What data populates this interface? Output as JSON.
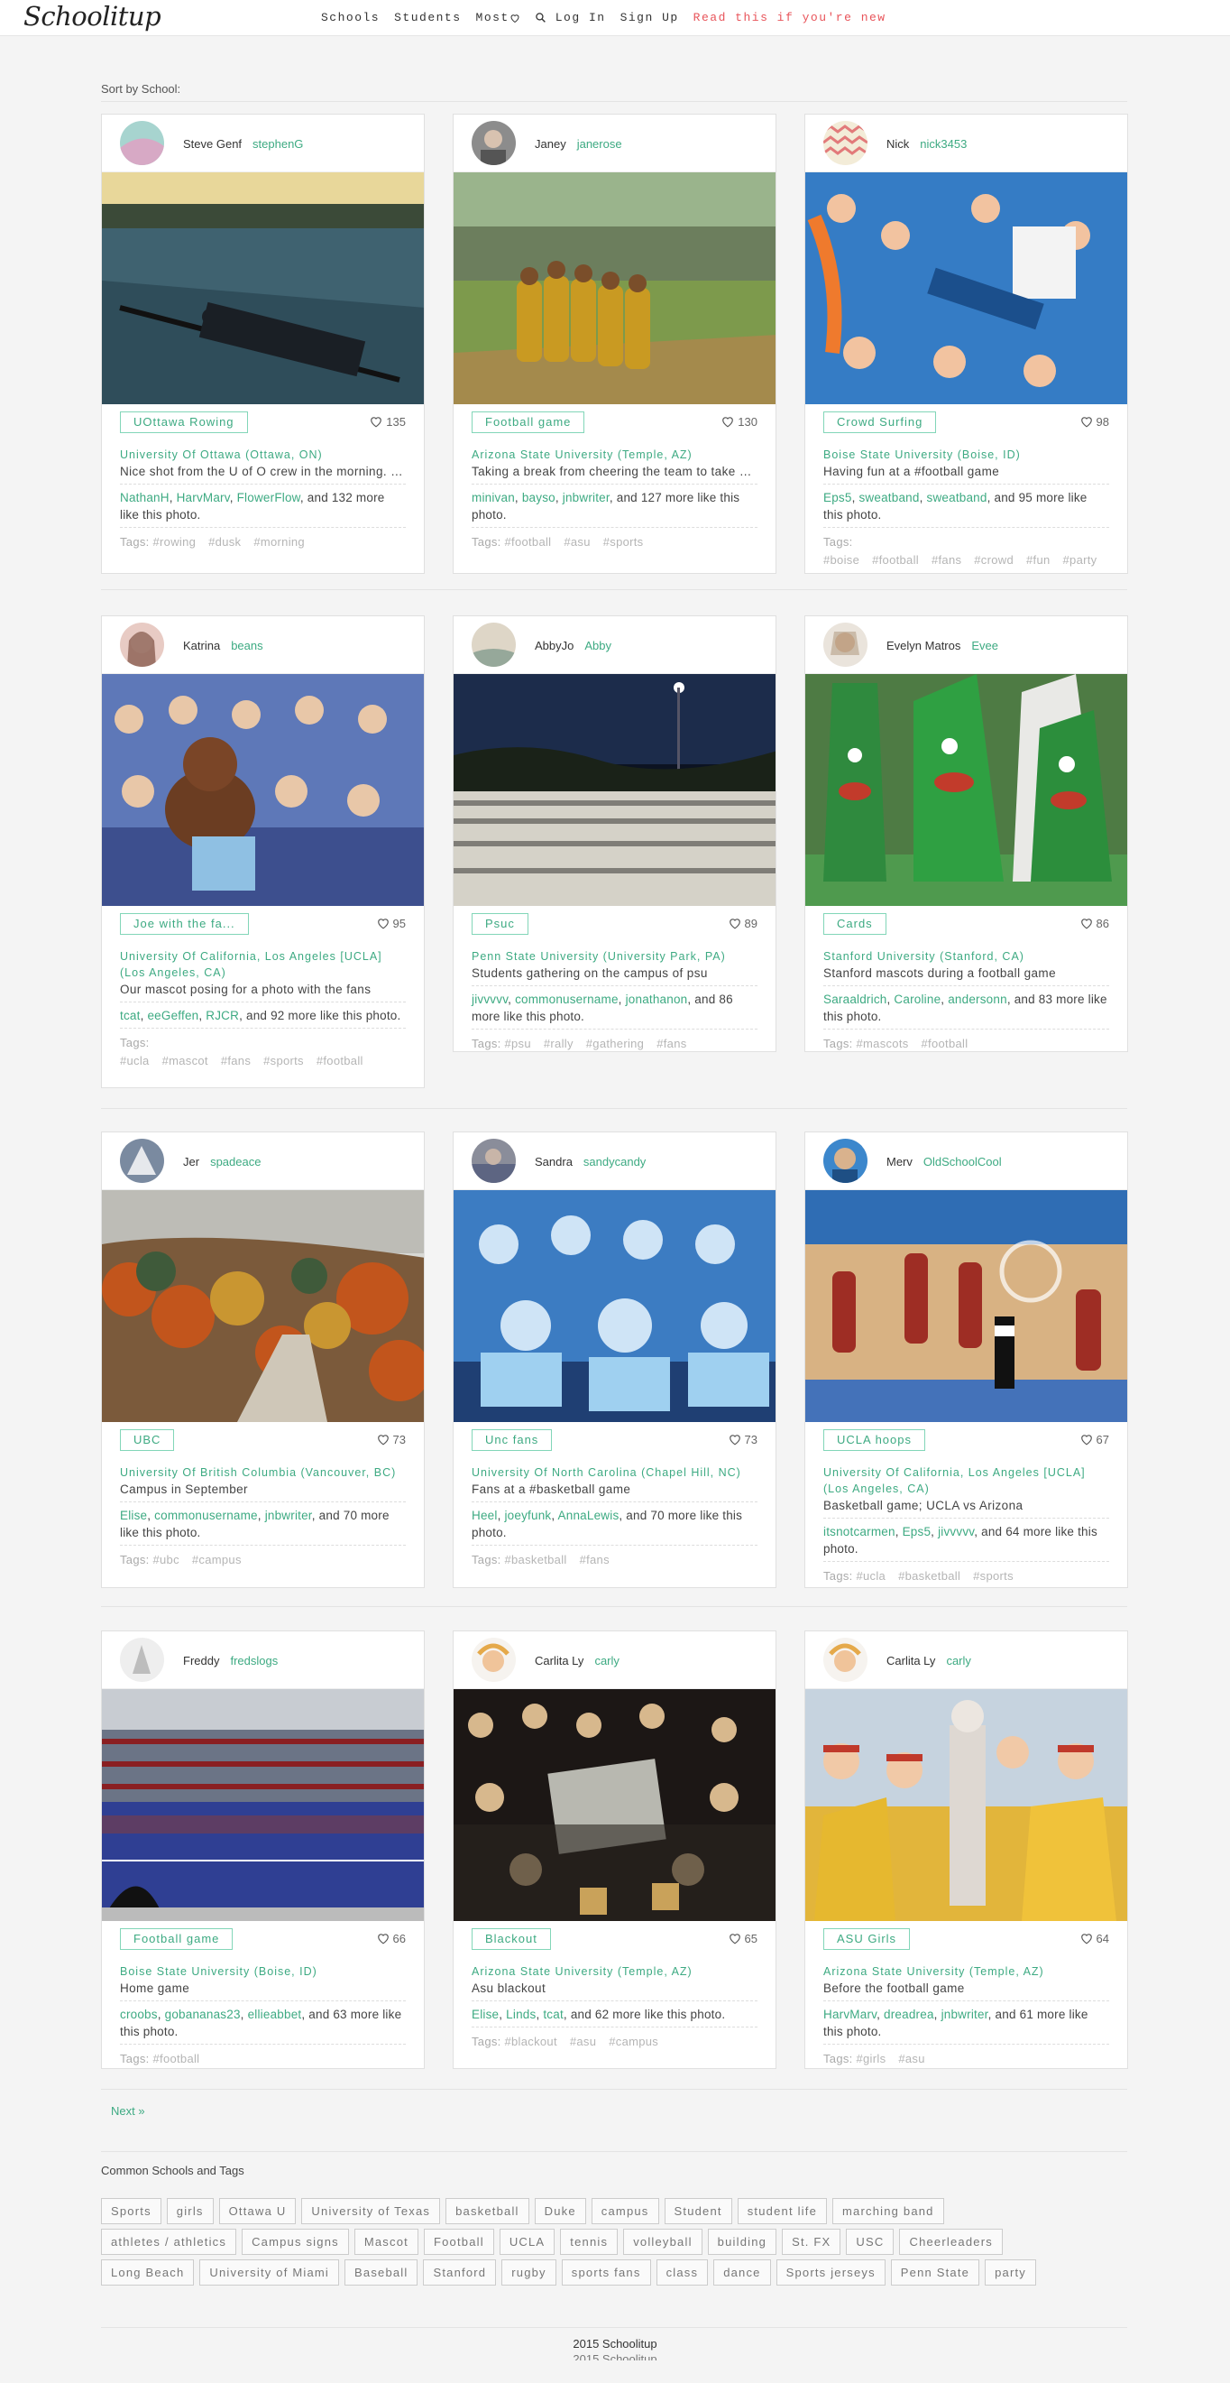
{
  "header": {
    "logo": "Schoolitup",
    "nav": {
      "schools": "Schools",
      "students": "Students",
      "most": "Most",
      "login": "Log In",
      "signup": "Sign Up",
      "read": "Read this if you're new"
    }
  },
  "sort_label": "Sort by School:",
  "posts": [
    {
      "name": "Steve Genf",
      "handle": "stephenG",
      "tag": "UOttawa Rowing",
      "likes": "135",
      "school": "University Of Ottawa (Ottawa, ON)",
      "caption": "Nice shot from the U of O crew in the morning. One of the nicest photos I have s...",
      "likers": [
        "NathanH",
        "HarvMarv",
        "FlowerFlow"
      ],
      "more_text": ", and 132 more like this photo.",
      "tags_label": "Tags:",
      "tags": [
        "#rowing",
        "#dusk",
        "#morning"
      ]
    },
    {
      "name": "Janey",
      "handle": "janerose",
      "tag": "Football game",
      "likes": "130",
      "school": "Arizona State University (Temple, AZ)",
      "caption": "Taking a break from cheering the team to take a photo! ♥ ♥",
      "likers": [
        "minivan",
        "bayso",
        "jnbwriter"
      ],
      "more_text": ", and 127 more like this photo.",
      "tags_label": "Tags:",
      "tags": [
        "#football",
        "#asu",
        "#sports"
      ]
    },
    {
      "name": "Nick",
      "handle": "nick3453",
      "tag": "Crowd Surfing",
      "likes": "98",
      "school": "Boise State University (Boise, ID)",
      "caption": "Having fun at a #football game",
      "likers": [
        "Eps5",
        "sweatband",
        "sweatband"
      ],
      "more_text": ", and 95 more like this photo.",
      "tags_label": "Tags:",
      "tags": [
        "#boise",
        "#football",
        "#fans",
        "#crowd",
        "#fun",
        "#party"
      ]
    },
    {
      "name": "Katrina",
      "handle": "beans",
      "tag": "Joe with the fa...",
      "likes": "95",
      "school": "University Of California, Los Angeles [UCLA] (Los Angeles, CA)",
      "caption": "Our mascot posing for a photo with the fans",
      "likers": [
        "tcat",
        "eeGeffen",
        "RJCR"
      ],
      "more_text": ", and 92 more like this photo.",
      "tags_label": "Tags:",
      "tags": [
        "#ucla",
        "#mascot",
        "#fans",
        "#sports",
        "#football"
      ]
    },
    {
      "name": "AbbyJo",
      "handle": "Abby",
      "tag": "Psuc",
      "likes": "89",
      "school": "Penn State University (University Park, PA)",
      "caption": "Students gathering on the campus of psu",
      "likers": [
        "jivvvvv",
        "commonusername",
        "jonathanon"
      ],
      "more_text": ", and 86 more like this photo.",
      "tags_label": "Tags:",
      "tags": [
        "#psu",
        "#rally",
        "#gathering",
        "#fans"
      ]
    },
    {
      "name": "Evelyn Matros",
      "handle": "Evee",
      "tag": "Cards",
      "likes": "86",
      "school": "Stanford University (Stanford, CA)",
      "caption": "Stanford mascots during a football game",
      "likers": [
        "Saraaldrich",
        "Caroline",
        "andersonn"
      ],
      "more_text": ", and 83 more like this photo.",
      "tags_label": "Tags:",
      "tags": [
        "#mascots",
        "#football"
      ]
    },
    {
      "name": "Jer",
      "handle": "spadeace",
      "tag": "UBC",
      "likes": "73",
      "school": "University Of British Columbia (Vancouver, BC)",
      "caption": "Campus in September",
      "likers": [
        "Elise",
        "commonusername",
        "jnbwriter"
      ],
      "more_text": ", and 70 more like this photo.",
      "tags_label": "Tags:",
      "tags": [
        "#ubc",
        "#campus"
      ]
    },
    {
      "name": "Sandra",
      "handle": "sandycandy",
      "tag": "Unc fans",
      "likes": "73",
      "school": "University Of North Carolina (Chapel Hill, NC)",
      "caption": "Fans at a #basketball game",
      "likers": [
        "Heel",
        "joeyfunk",
        "AnnaLewis"
      ],
      "more_text": ", and 70 more like this photo.",
      "tags_label": "Tags:",
      "tags": [
        "#basketball",
        "#fans"
      ]
    },
    {
      "name": "Merv",
      "handle": "OldSchoolCool",
      "tag": "UCLA hoops",
      "likes": "67",
      "school": "University Of California, Los Angeles [UCLA] (Los Angeles, CA)",
      "caption": "Basketball game; UCLA vs Arizona",
      "likers": [
        "itsnotcarmen",
        "Eps5",
        "jivvvvv"
      ],
      "more_text": ", and 64 more like this photo.",
      "tags_label": "Tags:",
      "tags": [
        "#ucla",
        "#basketball",
        "#sports"
      ]
    },
    {
      "name": "Freddy",
      "handle": "fredslogs",
      "tag": "Football game",
      "likes": "66",
      "school": "Boise State University (Boise, ID)",
      "caption": "Home game",
      "likers": [
        "croobs",
        "gobananas23",
        "ellieabbet"
      ],
      "more_text": ", and 63 more like this photo.",
      "tags_label": "Tags:",
      "tags": [
        "#football"
      ]
    },
    {
      "name": "Carlita Ly",
      "handle": "carly",
      "tag": "Blackout",
      "likes": "65",
      "school": "Arizona State University (Temple, AZ)",
      "caption": "Asu blackout",
      "likers": [
        "Elise",
        "Linds",
        "tcat"
      ],
      "more_text": ", and 62 more like this photo.",
      "tags_label": "Tags:",
      "tags": [
        "#blackout",
        "#asu",
        "#campus"
      ]
    },
    {
      "name": "Carlita Ly",
      "handle": "carly",
      "tag": "ASU Girls",
      "likes": "64",
      "school": "Arizona State University (Temple, AZ)",
      "caption": "Before the football game",
      "likers": [
        "HarvMarv",
        "dreadrea",
        "jnbwriter"
      ],
      "more_text": ", and 61 more like this photo.",
      "tags_label": "Tags:",
      "tags": [
        "#girls",
        "#asu"
      ]
    }
  ],
  "next_label": "Next »",
  "common_title": "Common Schools and Tags",
  "chip_rows": [
    [
      "Sports",
      "girls",
      "Ottawa U",
      "University of Texas",
      "basketball",
      "Duke",
      "campus",
      "Student",
      "student life",
      "marching band"
    ],
    [
      "athletes / athletics",
      "Campus signs",
      "Mascot",
      "Football",
      "UCLA",
      "tennis",
      "volleyball",
      "building",
      "St. FX",
      "USC",
      "Cheerleaders"
    ],
    [
      "Long Beach",
      "University of Miami",
      "Baseball",
      "Stanford",
      "rugby",
      "sports fans",
      "class",
      "dance",
      "Sports jerseys",
      "Penn State",
      "party"
    ]
  ],
  "footer": "2015 Schoolitup",
  "colors": {
    "accent": "#3daa82",
    "alert": "#e8545a",
    "background": "#f4f4f4"
  }
}
